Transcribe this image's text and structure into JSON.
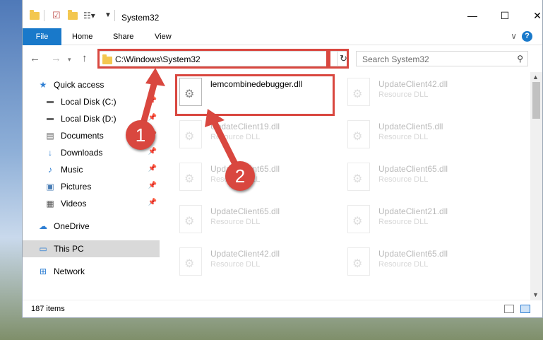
{
  "window": {
    "title": "System32",
    "controls": {
      "minimize": "—",
      "maximize": "☐",
      "close": "✕"
    }
  },
  "ribbon": {
    "file": "File",
    "tabs": [
      "Home",
      "Share",
      "View"
    ],
    "help": "?"
  },
  "navigation": {
    "address": "C:\\Windows\\System32",
    "search_placeholder": "Search System32"
  },
  "sidebar": {
    "items": [
      {
        "label": "Quick access",
        "icon": "star-icon",
        "pinned": false
      },
      {
        "label": "Local Disk (C:)",
        "icon": "drive-icon",
        "pinned": true
      },
      {
        "label": "Local Disk (D:)",
        "icon": "drive-icon",
        "pinned": true
      },
      {
        "label": "Documents",
        "icon": "documents-icon",
        "pinned": true
      },
      {
        "label": "Downloads",
        "icon": "download-icon",
        "pinned": true
      },
      {
        "label": "Music",
        "icon": "music-icon",
        "pinned": true
      },
      {
        "label": "Pictures",
        "icon": "pictures-icon",
        "pinned": true
      },
      {
        "label": "Videos",
        "icon": "videos-icon",
        "pinned": true
      },
      {
        "label": "OneDrive",
        "icon": "cloud-icon",
        "pinned": false
      },
      {
        "label": "This PC",
        "icon": "computer-icon",
        "pinned": false,
        "selected": true
      },
      {
        "label": "Network",
        "icon": "network-icon",
        "pinned": false
      }
    ]
  },
  "files": [
    {
      "name": "lemcombinedebugger.dll",
      "type": "",
      "highlighted": true
    },
    {
      "name": "UpdateClient42.dll",
      "type": "Resource DLL"
    },
    {
      "name": "UpdateClient19.dll",
      "type": "Resource DLL"
    },
    {
      "name": "UpdateClient5.dll",
      "type": "Resource DLL"
    },
    {
      "name": "UpdateClient65.dll",
      "type": "Resource DLL"
    },
    {
      "name": "UpdateClient65.dll",
      "type": "Resource DLL"
    },
    {
      "name": "UpdateClient65.dll",
      "type": "Resource DLL"
    },
    {
      "name": "UpdateClient21.dll",
      "type": "Resource DLL"
    },
    {
      "name": "UpdateClient42.dll",
      "type": "Resource DLL"
    },
    {
      "name": "UpdateClient65.dll",
      "type": "Resource DLL"
    }
  ],
  "status": {
    "item_count": "187 items"
  },
  "annotations": {
    "badge_1": "1",
    "badge_2": "2",
    "color": "#d9473f"
  }
}
